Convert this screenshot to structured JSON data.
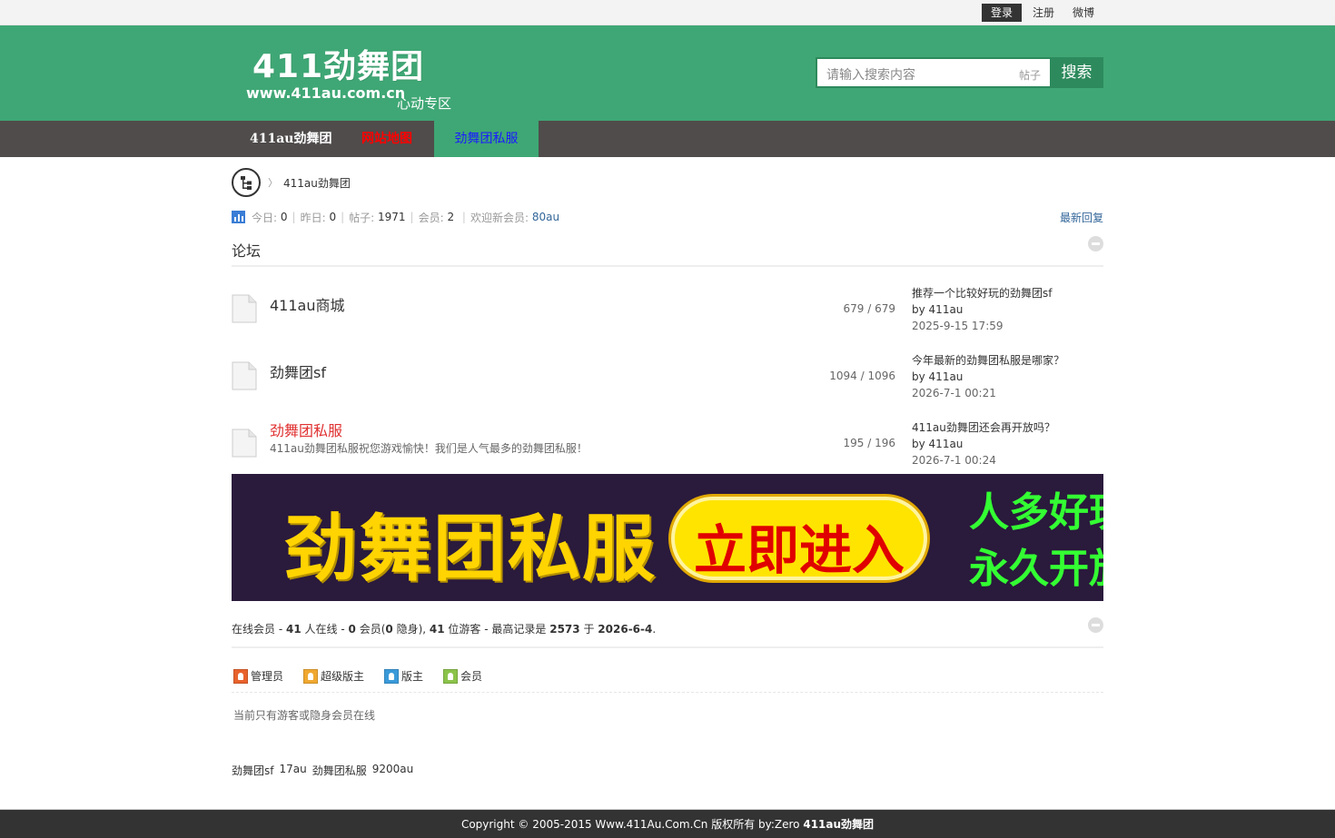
{
  "topbar": {
    "login": "登录",
    "register": "注册",
    "weibo": "微博"
  },
  "header": {
    "logo_title": "411劲舞团",
    "logo_url": "www.411au.com.cn",
    "logo_sub": "心动专区",
    "search_placeholder": "请输入搜索内容",
    "search_scope": "帖子",
    "search_button": "搜索"
  },
  "nav": [
    "411au劲舞团",
    "网站地图",
    "劲舞团私服"
  ],
  "breadcrumb": {
    "separator": "〉",
    "current": "411au劲舞团"
  },
  "stats": {
    "today_label": "今日:",
    "today": "0",
    "yesterday_label": "昨日:",
    "yesterday": "0",
    "posts_label": "帖子:",
    "posts": "1971",
    "members_label": "会员:",
    "members": "2",
    "welcome_label": "欢迎新会员:",
    "newest": "80au",
    "latest_link": "最新回复"
  },
  "section_title": "论坛",
  "forums": [
    {
      "name": "411au商城",
      "desc": "",
      "count": "679 / 679",
      "last_title": "推荐一个比较好玩的劲舞团sf",
      "by": "by",
      "last_user": "411au",
      "last_time": "2025-9-15 17:59"
    },
    {
      "name": "劲舞团sf",
      "desc": "",
      "count": "1094 / 1096",
      "last_title": "今年最新的劲舞团私服是哪家？",
      "by": "by",
      "last_user": "411au",
      "last_time": "2026-7-1 00:21"
    },
    {
      "name": "劲舞团私服",
      "desc": "411au劲舞团私服祝您游戏愉快！我们是人气最多的劲舞团私服！",
      "count": "195 / 196",
      "last_title": "411au劲舞团还会再开放吗？",
      "by": "by",
      "last_user": "411au",
      "last_time": "2026-7-1 00:24"
    }
  ],
  "banner": {
    "title": "劲舞团私服",
    "button": "立即进入",
    "line1": "人多好玩",
    "line2": "永久开放"
  },
  "online": {
    "label": "在线会员",
    "total": "41",
    "total_label": "人在线",
    "members": "0",
    "members_label": "会员(",
    "hidden": "0",
    "hidden_label": "隐身),",
    "guests": "41",
    "guests_label": "位游客 - 最高记录是",
    "record": "2573",
    "record_label": "于",
    "record_date": "2026-6-4"
  },
  "legend": [
    "管理员",
    "超级版主",
    "版主",
    "会员"
  ],
  "legend_colors": [
    "#e8622c",
    "#f0a830",
    "#3a9ad9",
    "#8bc34a"
  ],
  "only_guest": "当前只有游客或隐身会员在线",
  "friend_links": [
    "劲舞团sf",
    "17au",
    "劲舞团私服",
    "9200au"
  ],
  "footer": {
    "copyright": "Copyright © 2005-2015 Www.411Au.Com.Cn 版权所有 by:Zero",
    "brand": "411au劲舞团"
  }
}
